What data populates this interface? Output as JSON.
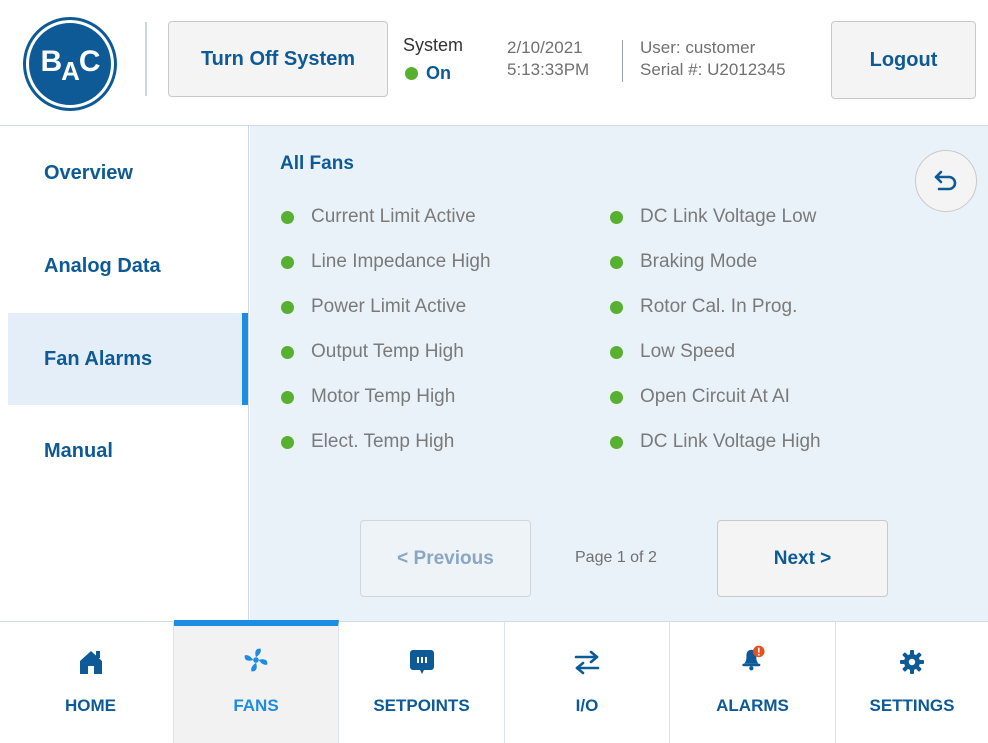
{
  "header": {
    "logo_text": "BAC",
    "turn_off_label": "Turn Off System",
    "system_label": "System",
    "system_status": "On",
    "date": "2/10/2021",
    "time": "5:13:33PM",
    "user": "User: customer",
    "serial": "Serial #: U2012345",
    "logout_label": "Logout"
  },
  "sidebar": {
    "items": [
      {
        "label": "Overview"
      },
      {
        "label": "Analog Data"
      },
      {
        "label": "Fan Alarms",
        "active": true
      },
      {
        "label": "Manual"
      }
    ]
  },
  "main": {
    "title": "All Fans",
    "alarms_left": [
      "Current Limit Active",
      "Line Impedance High",
      "Power Limit Active",
      "Output Temp High",
      "Motor Temp High",
      "Elect. Temp High"
    ],
    "alarms_right": [
      "DC Link Voltage Low",
      "Braking Mode",
      "Rotor Cal. In Prog.",
      "Low Speed",
      "Open Circuit At AI",
      "DC Link Voltage High"
    ],
    "status_color": "#57b030",
    "previous_label": "< Previous",
    "page_label": "Page 1 of 2",
    "next_label": "Next >"
  },
  "bottom_nav": {
    "items": [
      {
        "label": "HOME",
        "icon": "home-icon"
      },
      {
        "label": "FANS",
        "icon": "fan-icon",
        "active": true
      },
      {
        "label": "SETPOINTS",
        "icon": "setpoints-icon"
      },
      {
        "label": "I/O",
        "icon": "io-arrows-icon"
      },
      {
        "label": "ALARMS",
        "icon": "alarm-bell-icon"
      },
      {
        "label": "SETTINGS",
        "icon": "gear-icon"
      }
    ]
  },
  "colors": {
    "brand_blue": "#0d5a96",
    "accent_blue": "#1d8ce3",
    "active_green": "#57b030",
    "alert_orange": "#e8501c"
  }
}
